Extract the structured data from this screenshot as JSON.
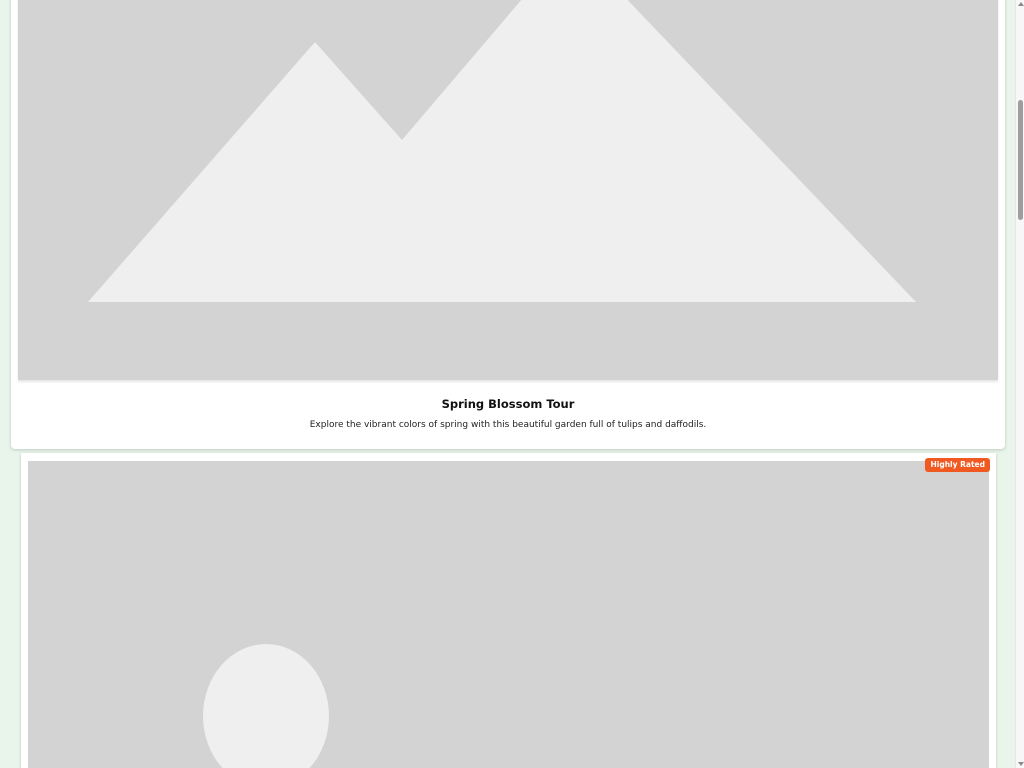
{
  "colors": {
    "page_background": "#e9f5ea",
    "card_background": "#ffffff",
    "image_placeholder": "#d3d3d3",
    "image_shape": "#efefef",
    "badge_background": "#f05a22",
    "badge_text": "#ffffff"
  },
  "cards": [
    {
      "image_icon": "mountain-placeholder-icon",
      "title": "Spring Blossom Tour",
      "description": "Explore the vibrant colors of spring with this beautiful garden full of tulips and daffodils."
    },
    {
      "image_icon": "sun-placeholder-icon",
      "badge": "Highly Rated"
    }
  ],
  "scrollbar": {
    "position_fraction": 0.13
  }
}
